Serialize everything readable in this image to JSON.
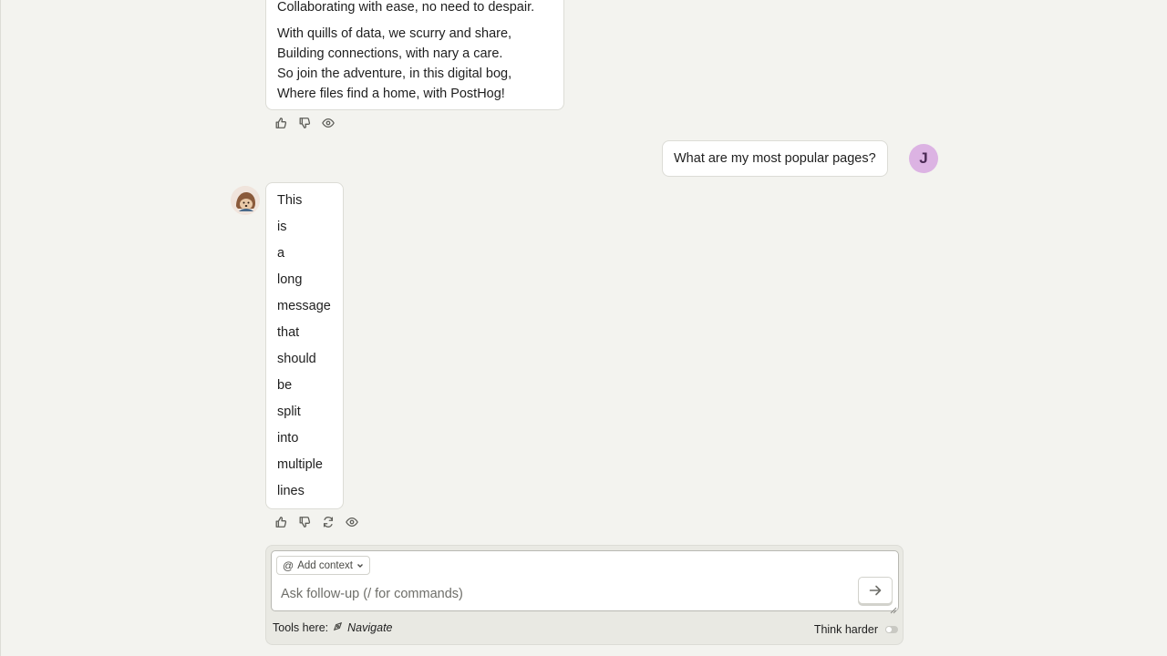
{
  "poem_message": {
    "lines_top": [
      "Collaborating with ease, no need to despair."
    ],
    "lines_bottom": [
      "With quills of data, we scurry and share,",
      "Building connections, with nary a care.",
      "So join the adventure, in this digital bog,",
      "Where files find a home, with PostHog!"
    ]
  },
  "user_message": {
    "text": "What are my most popular pages?",
    "avatar_initial": "J"
  },
  "long_message": {
    "words": [
      "This",
      "is",
      "a",
      "long",
      "message",
      "that",
      "should",
      "be",
      "split",
      "into",
      "multiple",
      "lines"
    ]
  },
  "icons": {
    "thumbs_up": "thumbs-up-icon",
    "thumbs_down": "thumbs-down-icon",
    "retry": "retry-icon",
    "view": "eye-icon",
    "send": "arrow-right-icon",
    "navigate": "compass-icon"
  },
  "composer": {
    "add_context_label": "Add context",
    "placeholder": "Ask follow-up (/ for commands)",
    "value": "",
    "tools_label": "Tools here:",
    "tool_name": "Navigate",
    "think_harder_label": "Think harder",
    "think_harder_on": false
  },
  "colors": {
    "background": "#f3f3ef",
    "bubble": "#ffffff",
    "user_avatar": "#dcb3e3",
    "composer_bg": "#e9e9e3"
  }
}
